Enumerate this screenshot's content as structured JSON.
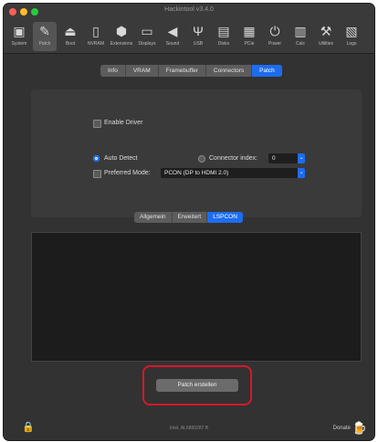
{
  "window": {
    "title": "Hackintool v3.4.0"
  },
  "toolbar": {
    "items": [
      {
        "label": "System",
        "icon": "system-icon",
        "glyph": "▣"
      },
      {
        "label": "Patch",
        "icon": "patch-icon",
        "glyph": "✎"
      },
      {
        "label": "Boot",
        "icon": "boot-icon",
        "glyph": "⏏"
      },
      {
        "label": "NVRAM",
        "icon": "nvram-icon",
        "glyph": "▯"
      },
      {
        "label": "Extensions",
        "icon": "extensions-icon",
        "glyph": "⬢"
      },
      {
        "label": "Displays",
        "icon": "displays-icon",
        "glyph": "▭"
      },
      {
        "label": "Sound",
        "icon": "sound-icon",
        "glyph": "◀"
      },
      {
        "label": "USB",
        "icon": "usb-icon",
        "glyph": "Ψ"
      },
      {
        "label": "Disks",
        "icon": "disks-icon",
        "glyph": "▤"
      },
      {
        "label": "PCIe",
        "icon": "pcie-icon",
        "glyph": "▦"
      },
      {
        "label": "Power",
        "icon": "power-icon",
        "glyph": "⏻"
      },
      {
        "label": "Calc",
        "icon": "calc-icon",
        "glyph": "▥"
      },
      {
        "label": "Utilities",
        "icon": "utilities-icon",
        "glyph": "⚒"
      },
      {
        "label": "Logs",
        "icon": "logs-icon",
        "glyph": "▧"
      }
    ],
    "active_index": 1
  },
  "tabs": {
    "items": [
      "Info",
      "VRAM",
      "Framebuffer",
      "Connectors",
      "Patch"
    ],
    "active_index": 4
  },
  "panel": {
    "enable_driver_label": "Enable Driver",
    "auto_detect_label": "Auto Detect",
    "connector_index_label": "Connector index:",
    "connector_index_value": "0",
    "preferred_mode_label": "Preferred Mode:",
    "preferred_mode_value": "PCON (DP to HDMI 2.0)"
  },
  "subtabs": {
    "items": [
      "Allgemein",
      "Erweitert",
      "LSPCON"
    ],
    "active_index": 2
  },
  "actions": {
    "create_patch_label": "Patch erstellen"
  },
  "footer": {
    "center_text": "Intel, AL6850287 B",
    "donate_label": "Donate"
  },
  "colors": {
    "accent": "#1d6cf0",
    "highlight": "#d5182c",
    "close": "#ff5f57",
    "minimize": "#febc2e",
    "zoom": "#28c840"
  }
}
